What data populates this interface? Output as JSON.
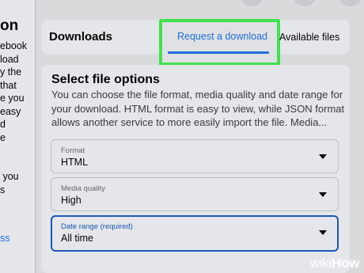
{
  "left_panel": {
    "title": "on",
    "text": "ebook\nload\ny the\nthat\ne you\neasy\nd\ne\n\n\n you\ns\n\n\n",
    "link": "ss"
  },
  "downloads_header": {
    "title": "Downloads",
    "tabs": [
      {
        "label": "Request a download",
        "active": true
      },
      {
        "label": "Available files",
        "active": false
      }
    ]
  },
  "file_options": {
    "title": "Select file options",
    "description": "You can choose the file format, media quality and date range for your download. HTML format is easy to view, while JSON format allows another service to more easily import the file. Media..."
  },
  "selects": [
    {
      "label": "Format",
      "value": "HTML"
    },
    {
      "label": "Media quality",
      "value": "High"
    },
    {
      "label": "Date range (required)",
      "value": "All time",
      "focused": true
    }
  ],
  "watermark": {
    "wiki": "wiki",
    "how": "How"
  },
  "colors": {
    "highlight_frame": "#3fe34a",
    "accent_blue": "#216fdb",
    "focus_border": "#1d56b8",
    "card_bg": "#e4e6e9",
    "page_bg": "#d9dadc"
  }
}
